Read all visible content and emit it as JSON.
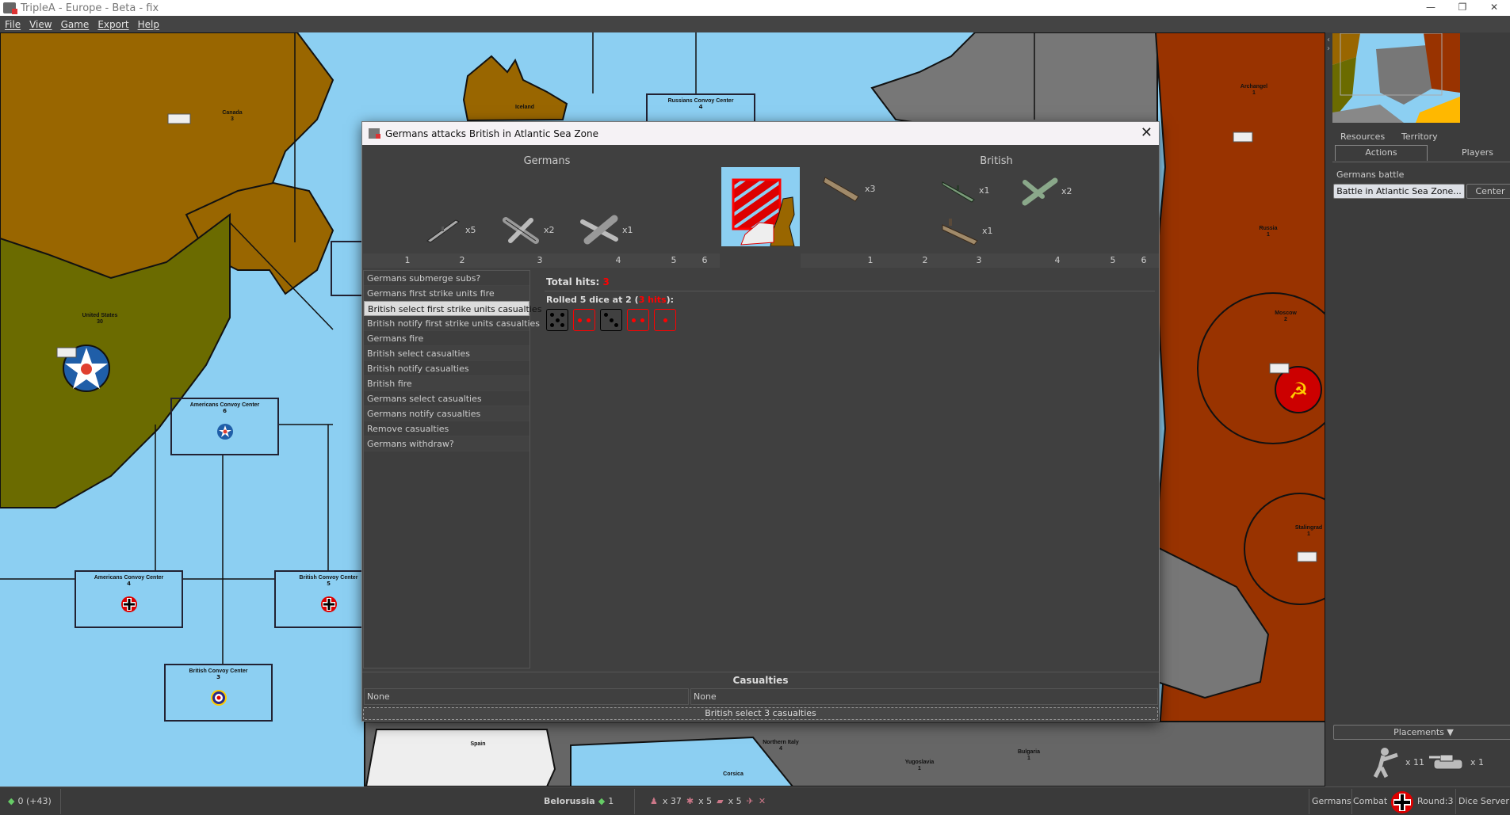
{
  "window": {
    "title": "TripleA - Europe - Beta - fix",
    "controls": [
      "—",
      "❐",
      "✕"
    ]
  },
  "menu": [
    "File",
    "View",
    "Game",
    "Export",
    "Help"
  ],
  "map": {
    "colors": {
      "sea": "#8ccff2",
      "canada": "#996600",
      "usa": "#6b6b00",
      "axis": "#777777",
      "neutral": "#eeeeee",
      "russia": "#993300"
    },
    "territories": [
      {
        "name": "Canada",
        "value": "3"
      },
      {
        "name": "Iceland",
        "value": ""
      },
      {
        "name": "United States",
        "value": "30"
      },
      {
        "name": "Archangel",
        "value": "1"
      },
      {
        "name": "Russia",
        "value": "1"
      },
      {
        "name": "Moscow",
        "value": "2"
      },
      {
        "name": "Stalingrad",
        "value": "1"
      },
      {
        "name": "Spain",
        "value": ""
      },
      {
        "name": "Corsica",
        "value": ""
      },
      {
        "name": "Northern Italy",
        "value": "4"
      },
      {
        "name": "Yugoslavia",
        "value": "1"
      },
      {
        "name": "Bulgaria",
        "value": "1"
      }
    ],
    "convoys": [
      {
        "name": "Americans Convoy Center",
        "value": "6",
        "roundel": "usa-roundel-icon"
      },
      {
        "name": "Americans Convoy Center",
        "value": "4",
        "roundel": "german-cross-icon"
      },
      {
        "name": "British Convoy Center",
        "value": "5",
        "roundel": "german-cross-icon"
      },
      {
        "name": "British Convoy Center",
        "value": "3",
        "roundel": "raf-roundel-icon"
      },
      {
        "name": "Russians Convoy Center",
        "value": "4",
        "roundel": "soviet-roundel-icon"
      }
    ]
  },
  "dialog": {
    "title": "Germans attacks British in Atlantic Sea Zone",
    "attacker": {
      "name": "Germans",
      "columns": [
        "1",
        "2",
        "3",
        "4",
        "5",
        "6"
      ],
      "units": [
        {
          "icon": "submarine-icon",
          "count": "x5"
        },
        {
          "icon": "fighter-icon",
          "count": "x2"
        },
        {
          "icon": "bomber-icon",
          "count": "x1"
        }
      ]
    },
    "defender": {
      "name": "British",
      "columns": [
        "1",
        "2",
        "3",
        "4",
        "5",
        "6"
      ],
      "units": [
        {
          "icon": "transport-icon",
          "count": "x3"
        },
        {
          "icon": "destroyer-icon",
          "count": "x1"
        },
        {
          "icon": "fighter-icon",
          "count": "x2"
        },
        {
          "icon": "carrier-icon",
          "count": "x1"
        }
      ]
    },
    "steps": [
      "Germans submerge subs?",
      "Germans first strike units fire",
      "British select first strike units casualties",
      "British notify first strike units casualties",
      "Germans fire",
      "British select casualties",
      "British notify casualties",
      "British fire",
      "Germans select casualties",
      "Germans notify casualties",
      "Remove casualties",
      "Germans withdraw?"
    ],
    "selected_step": 2,
    "total_hits_label": "Total hits:",
    "total_hits": "3",
    "rolled_prefix": "Rolled 5 dice at 2 (",
    "rolled_hits": "3 hits",
    "rolled_suffix": "):",
    "dice": [
      {
        "value": 5,
        "hit": false
      },
      {
        "value": 2,
        "hit": true
      },
      {
        "value": 3,
        "hit": false
      },
      {
        "value": 2,
        "hit": true
      },
      {
        "value": 1,
        "hit": true
      }
    ],
    "casualties_title": "Casualties",
    "casualties_attacker": "None",
    "casualties_defender": "None",
    "action_button": "British select 3 casualties"
  },
  "right_panel": {
    "tabs_row1": [
      "Resources",
      "Territory"
    ],
    "tabs_row2": [
      "Actions",
      "Players"
    ],
    "active_tab": "Actions",
    "section_label": "Germans battle",
    "battle_button": "Battle in Atlantic Sea Zone...",
    "center_button": "Center",
    "placements_label": "Placements ▼",
    "placements": [
      {
        "icon": "infantry-icon",
        "count": "x 11"
      },
      {
        "icon": "tank-icon",
        "count": "x 1"
      }
    ]
  },
  "status_bar": {
    "pus": "0 (+43)",
    "territory": "Belorussia",
    "territory_value": "1",
    "units": [
      {
        "icon": "infantry-icon",
        "count": "x 37"
      },
      {
        "icon": "artillery-icon",
        "count": "x 5"
      },
      {
        "icon": "tank-icon",
        "count": "x 5"
      },
      {
        "icon": "fighter-icon",
        "count": ""
      },
      {
        "icon": "aa-gun-icon",
        "count": ""
      }
    ],
    "player": "Germans",
    "phase": "Combat",
    "round": "Round:3",
    "dice": "Dice Server"
  }
}
